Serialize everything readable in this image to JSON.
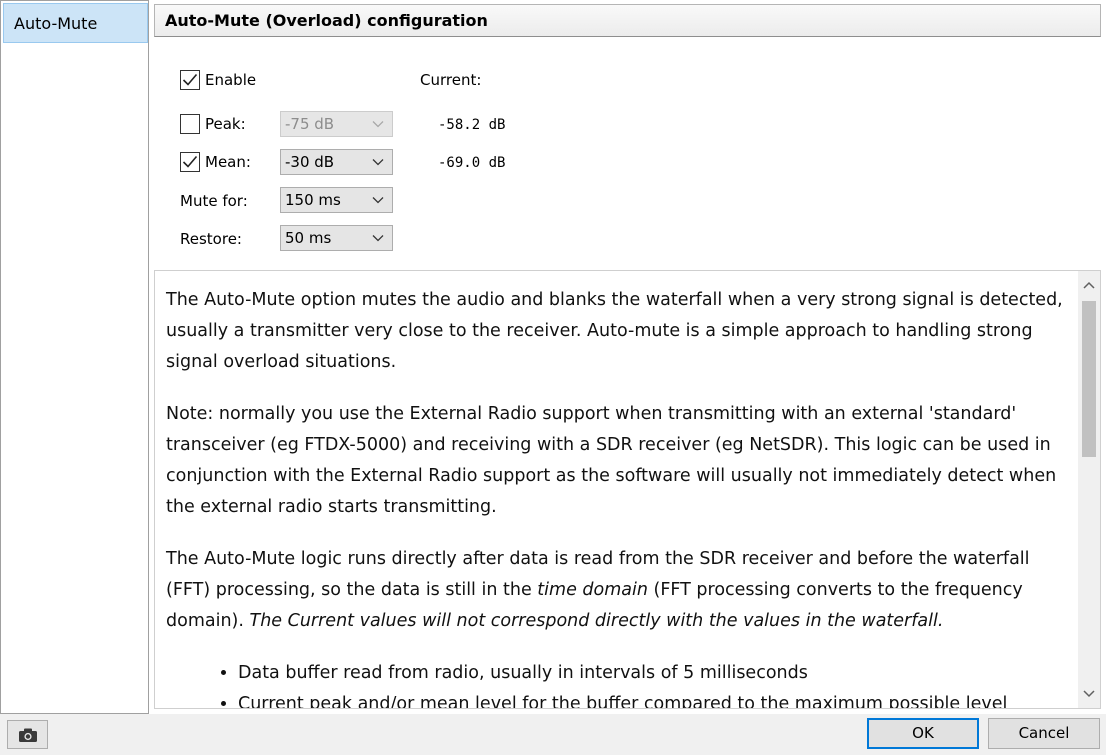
{
  "sidebar": {
    "items": [
      {
        "label": "Auto-Mute"
      }
    ]
  },
  "header": {
    "title": "Auto-Mute (Overload) configuration"
  },
  "form": {
    "enable": {
      "label": "Enable",
      "checked": true
    },
    "current_label": "Current:",
    "peak": {
      "label": "Peak:",
      "checked": false,
      "value": "-75 dB",
      "current": "-58.2 dB",
      "disabled": true
    },
    "mean": {
      "label": "Mean:",
      "checked": true,
      "value": "-30 dB",
      "current": "-69.0 dB"
    },
    "mute_for": {
      "label": "Mute for:",
      "value": "150 ms"
    },
    "restore": {
      "label": "Restore:",
      "value": "50 ms"
    }
  },
  "help": {
    "p1": "The Auto-Mute option mutes the audio and blanks the waterfall when a very strong signal is detected, usually a transmitter very close to the receiver. Auto-mute is a simple approach to handling strong signal overload situations.",
    "p2": "Note: normally you use the External Radio support when transmitting with an external 'standard' transceiver (eg FTDX-5000) and receiving with a SDR receiver (eg NetSDR). This logic can be used in conjunction with the External Radio support as the software will usually not immediately detect when the external radio starts transmitting.",
    "p3_a": "The Auto-Mute logic runs directly after data is read from the SDR receiver and before the waterfall (FFT) processing, so the data is still in the ",
    "p3_em1": "time domain",
    "p3_b": " (FFT processing converts to the frequency domain). ",
    "p3_em2": "The Current values will not correspond directly with the values in the waterfall.",
    "bullets": [
      "Data buffer read from radio, usually in intervals of 5 milliseconds",
      "Current peak and/or mean level for the buffer compared to the maximum possible level"
    ]
  },
  "footer": {
    "camera_icon": "camera-icon",
    "ok_label": "OK",
    "cancel_label": "Cancel"
  },
  "colors": {
    "accent": "#0078d7",
    "selection": "#cce4f7"
  }
}
